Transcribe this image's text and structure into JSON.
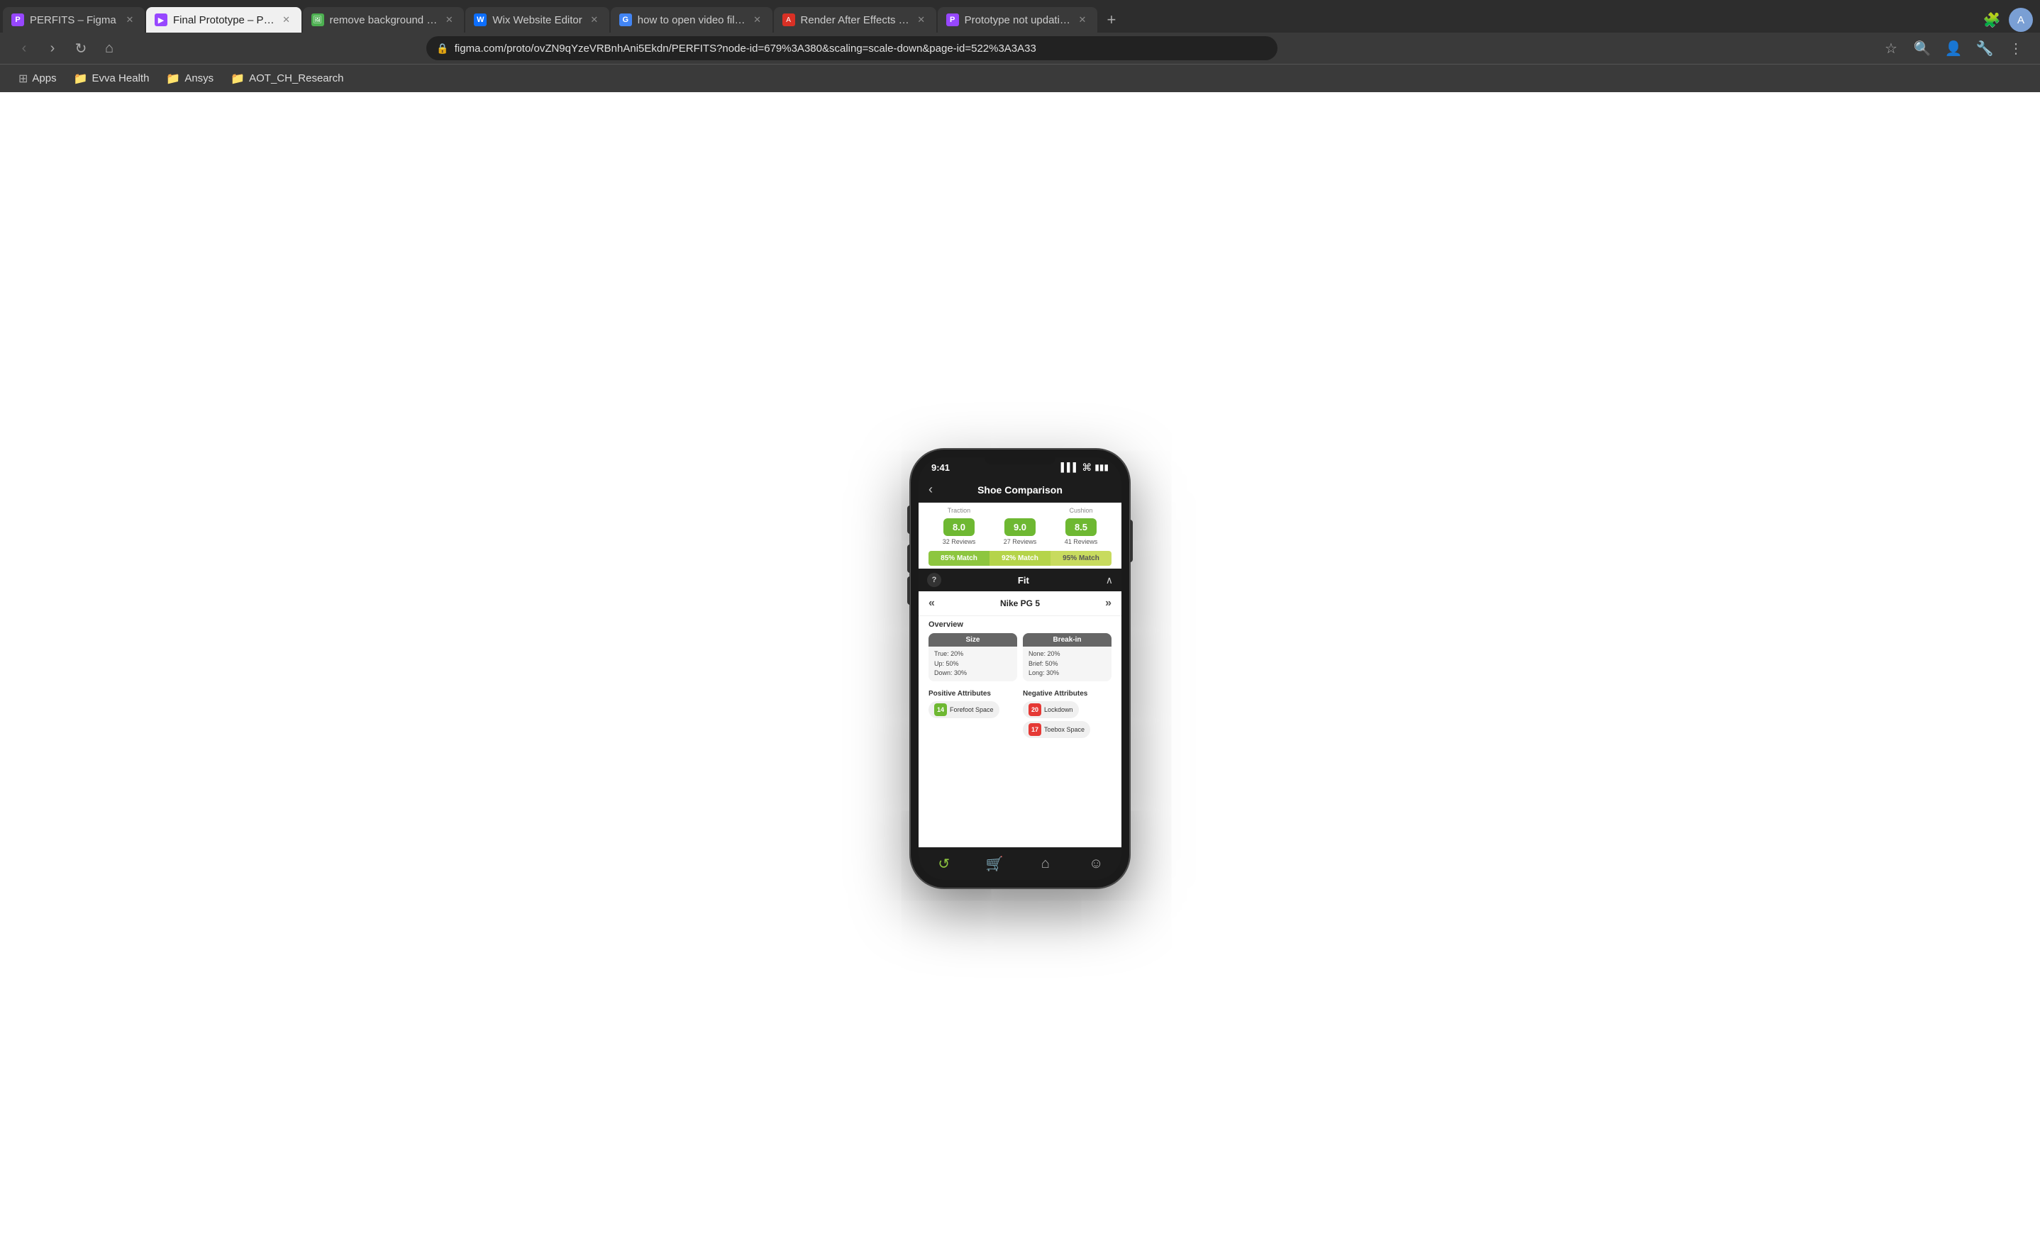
{
  "browser": {
    "tabs": [
      {
        "id": "tab1",
        "favicon": "P",
        "favicon_color": "#9747FF",
        "label": "PERFITS – Figma",
        "active": false
      },
      {
        "id": "tab2",
        "favicon": "►",
        "favicon_color": "#9747FF",
        "label": "Final Prototype – P…",
        "active": true
      },
      {
        "id": "tab3",
        "favicon": "🖼",
        "favicon_color": "#4CAF50",
        "label": "remove background …",
        "active": false
      },
      {
        "id": "tab4",
        "favicon": "W",
        "favicon_color": "#0C6EFD",
        "label": "Wix Website Editor",
        "active": false
      },
      {
        "id": "tab5",
        "favicon": "G",
        "favicon_color": "#4285F4",
        "label": "how to open video fil…",
        "active": false
      },
      {
        "id": "tab6",
        "favicon": "A",
        "favicon_color": "#D93025",
        "label": "Render After Effects …",
        "active": false
      },
      {
        "id": "tab7",
        "favicon": "P",
        "favicon_color": "#9747FF",
        "label": "Prototype not updati…",
        "active": false
      }
    ],
    "address": "figma.com/proto/ovZN9qYzeVRBnhAni5Ekdn/PERFITS?node-id=679%3A380&scaling=scale-down&page-id=522%3A3A33",
    "bookmarks": [
      {
        "icon": "📱",
        "label": "Apps"
      },
      {
        "icon": "📁",
        "label": "Evva Health"
      },
      {
        "icon": "📁",
        "label": "Ansys"
      },
      {
        "icon": "📁",
        "label": "AOT_CH_Research"
      }
    ]
  },
  "phone": {
    "status_bar": {
      "time": "9:41",
      "signal": "▌▌▌",
      "wifi": "wifi",
      "battery": "battery"
    },
    "header": {
      "title": "Shoe Comparison",
      "back_icon": "‹"
    },
    "score_section": {
      "columns": [
        {
          "label": "Traction",
          "score": "8.0",
          "reviews": "32 Reviews"
        },
        {
          "label": "",
          "score": "9.0",
          "reviews": "27 Reviews"
        },
        {
          "label": "Cushion",
          "score": "8.5",
          "reviews": "41 Reviews"
        }
      ],
      "matches": [
        {
          "label": "85% Match",
          "level": "low"
        },
        {
          "label": "92% Match",
          "level": "mid"
        },
        {
          "label": "95% Match",
          "level": "high"
        }
      ]
    },
    "fit_section": {
      "title": "Fit",
      "help_icon": "?",
      "chevron": "∧",
      "product_nav": {
        "prev": "«",
        "current": "Nike PG 5",
        "next": "»"
      },
      "overview_label": "Overview",
      "size_card": {
        "header": "Size",
        "lines": [
          "True: 20%",
          "Up: 50%",
          "Down: 30%"
        ]
      },
      "break_in_card": {
        "header": "Break-in",
        "lines": [
          "None: 20%",
          "Brief: 50%",
          "Long: 30%"
        ]
      },
      "positive_label": "Positive Attributes",
      "negative_label": "Negative Attributes",
      "positive_tags": [
        {
          "count": "14",
          "label": "Forefoot Space"
        }
      ],
      "negative_tags": [
        {
          "count": "20",
          "label": "Lockdown"
        },
        {
          "count": "17",
          "label": "Toebox Space"
        }
      ]
    },
    "bottom_nav": [
      {
        "icon": "↺",
        "label": "refresh",
        "active": true
      },
      {
        "icon": "🛒",
        "label": "cart",
        "active": false
      },
      {
        "icon": "⌂",
        "label": "home",
        "active": false
      },
      {
        "icon": "☺",
        "label": "profile",
        "active": false
      }
    ]
  }
}
